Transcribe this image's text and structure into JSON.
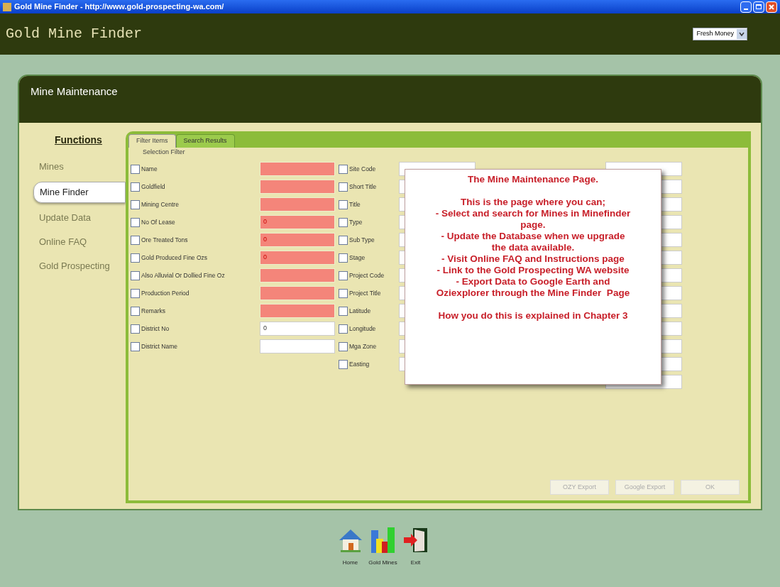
{
  "window": {
    "title": "Gold Mine Finder - http://www.gold-prospecting-wa.com/"
  },
  "header": {
    "title": "Gold Mine Finder",
    "dropdown": "Fresh Money"
  },
  "panel": {
    "title": "Mine Maintenance"
  },
  "sidebar": {
    "heading": "Functions",
    "items": [
      {
        "label": "Mines",
        "selected": false
      },
      {
        "label": "Mine Finder",
        "selected": true
      },
      {
        "label": "Update Data",
        "selected": false
      },
      {
        "label": "Online FAQ",
        "selected": false
      },
      {
        "label": "Gold Prospecting",
        "selected": false
      }
    ]
  },
  "tabs": [
    {
      "label": "Filter Items",
      "selected": true
    },
    {
      "label": "Search Results",
      "selected": false
    }
  ],
  "filter": {
    "title": "Selection Filter",
    "column_1": [
      {
        "label": "Name",
        "checked": false,
        "highlighted": true
      },
      {
        "label": "Goldfield",
        "checked": false,
        "highlighted": true
      },
      {
        "label": "Mining Centre",
        "checked": false,
        "highlighted": true
      },
      {
        "label": "No Of Lease",
        "checked": false,
        "value": "0",
        "highlighted": true
      },
      {
        "label": "Ore Treated Tons",
        "checked": false,
        "value": "0",
        "highlighted": true
      },
      {
        "label": "Gold Produced Fine Ozs",
        "checked": false,
        "value": "0",
        "highlighted": true
      },
      {
        "label": "Also Alluvial Or Dollied Fine Oz",
        "checked": false,
        "highlighted": true
      },
      {
        "label": "Production Period",
        "checked": false,
        "highlighted": true
      },
      {
        "label": "Remarks",
        "checked": false,
        "highlighted": true
      },
      {
        "label": "District No",
        "checked": false,
        "value": "0",
        "highlighted": false
      },
      {
        "label": "District Name",
        "checked": false,
        "highlighted": false
      }
    ],
    "column_2": [
      {
        "label": "Site Code",
        "checked": false
      },
      {
        "label": "Short Title",
        "checked": false
      },
      {
        "label": "Title",
        "checked": false
      },
      {
        "label": "Type",
        "checked": false
      },
      {
        "label": "Sub Type",
        "checked": false
      },
      {
        "label": "Stage",
        "checked": false
      },
      {
        "label": "Project Code",
        "checked": false
      },
      {
        "label": "Project Title",
        "checked": false
      },
      {
        "label": "Latitude",
        "checked": false
      },
      {
        "label": "Longitude",
        "checked": false
      },
      {
        "label": "Mga Zone",
        "checked": false
      },
      {
        "label": "Easting",
        "checked": false
      }
    ]
  },
  "buttons": [
    {
      "label": "OZY Export",
      "disabled": true
    },
    {
      "label": "Google Export",
      "disabled": true
    },
    {
      "label": "OK",
      "disabled": true
    }
  ],
  "popup": {
    "sections": [
      [
        "The Mine Maintenance Page."
      ],
      [
        "This is the page where you can;",
        "- Select and search for Mines in Minefinder",
        "page.",
        "- Update the Database when we upgrade",
        "the data available.",
        "- Visit Online FAQ and Instructions page",
        "- Link to the Gold Prospecting WA website",
        "- Export Data to Google Earth and",
        "Oziexplorer through the Mine Finder  Page"
      ],
      [
        "How you do this is explained in Chapter 3"
      ]
    ]
  },
  "toolbar": [
    {
      "kind": "home",
      "label": "Home"
    },
    {
      "kind": "chart",
      "label": "Gold Mines"
    },
    {
      "kind": "exit",
      "label": "Exit"
    }
  ]
}
